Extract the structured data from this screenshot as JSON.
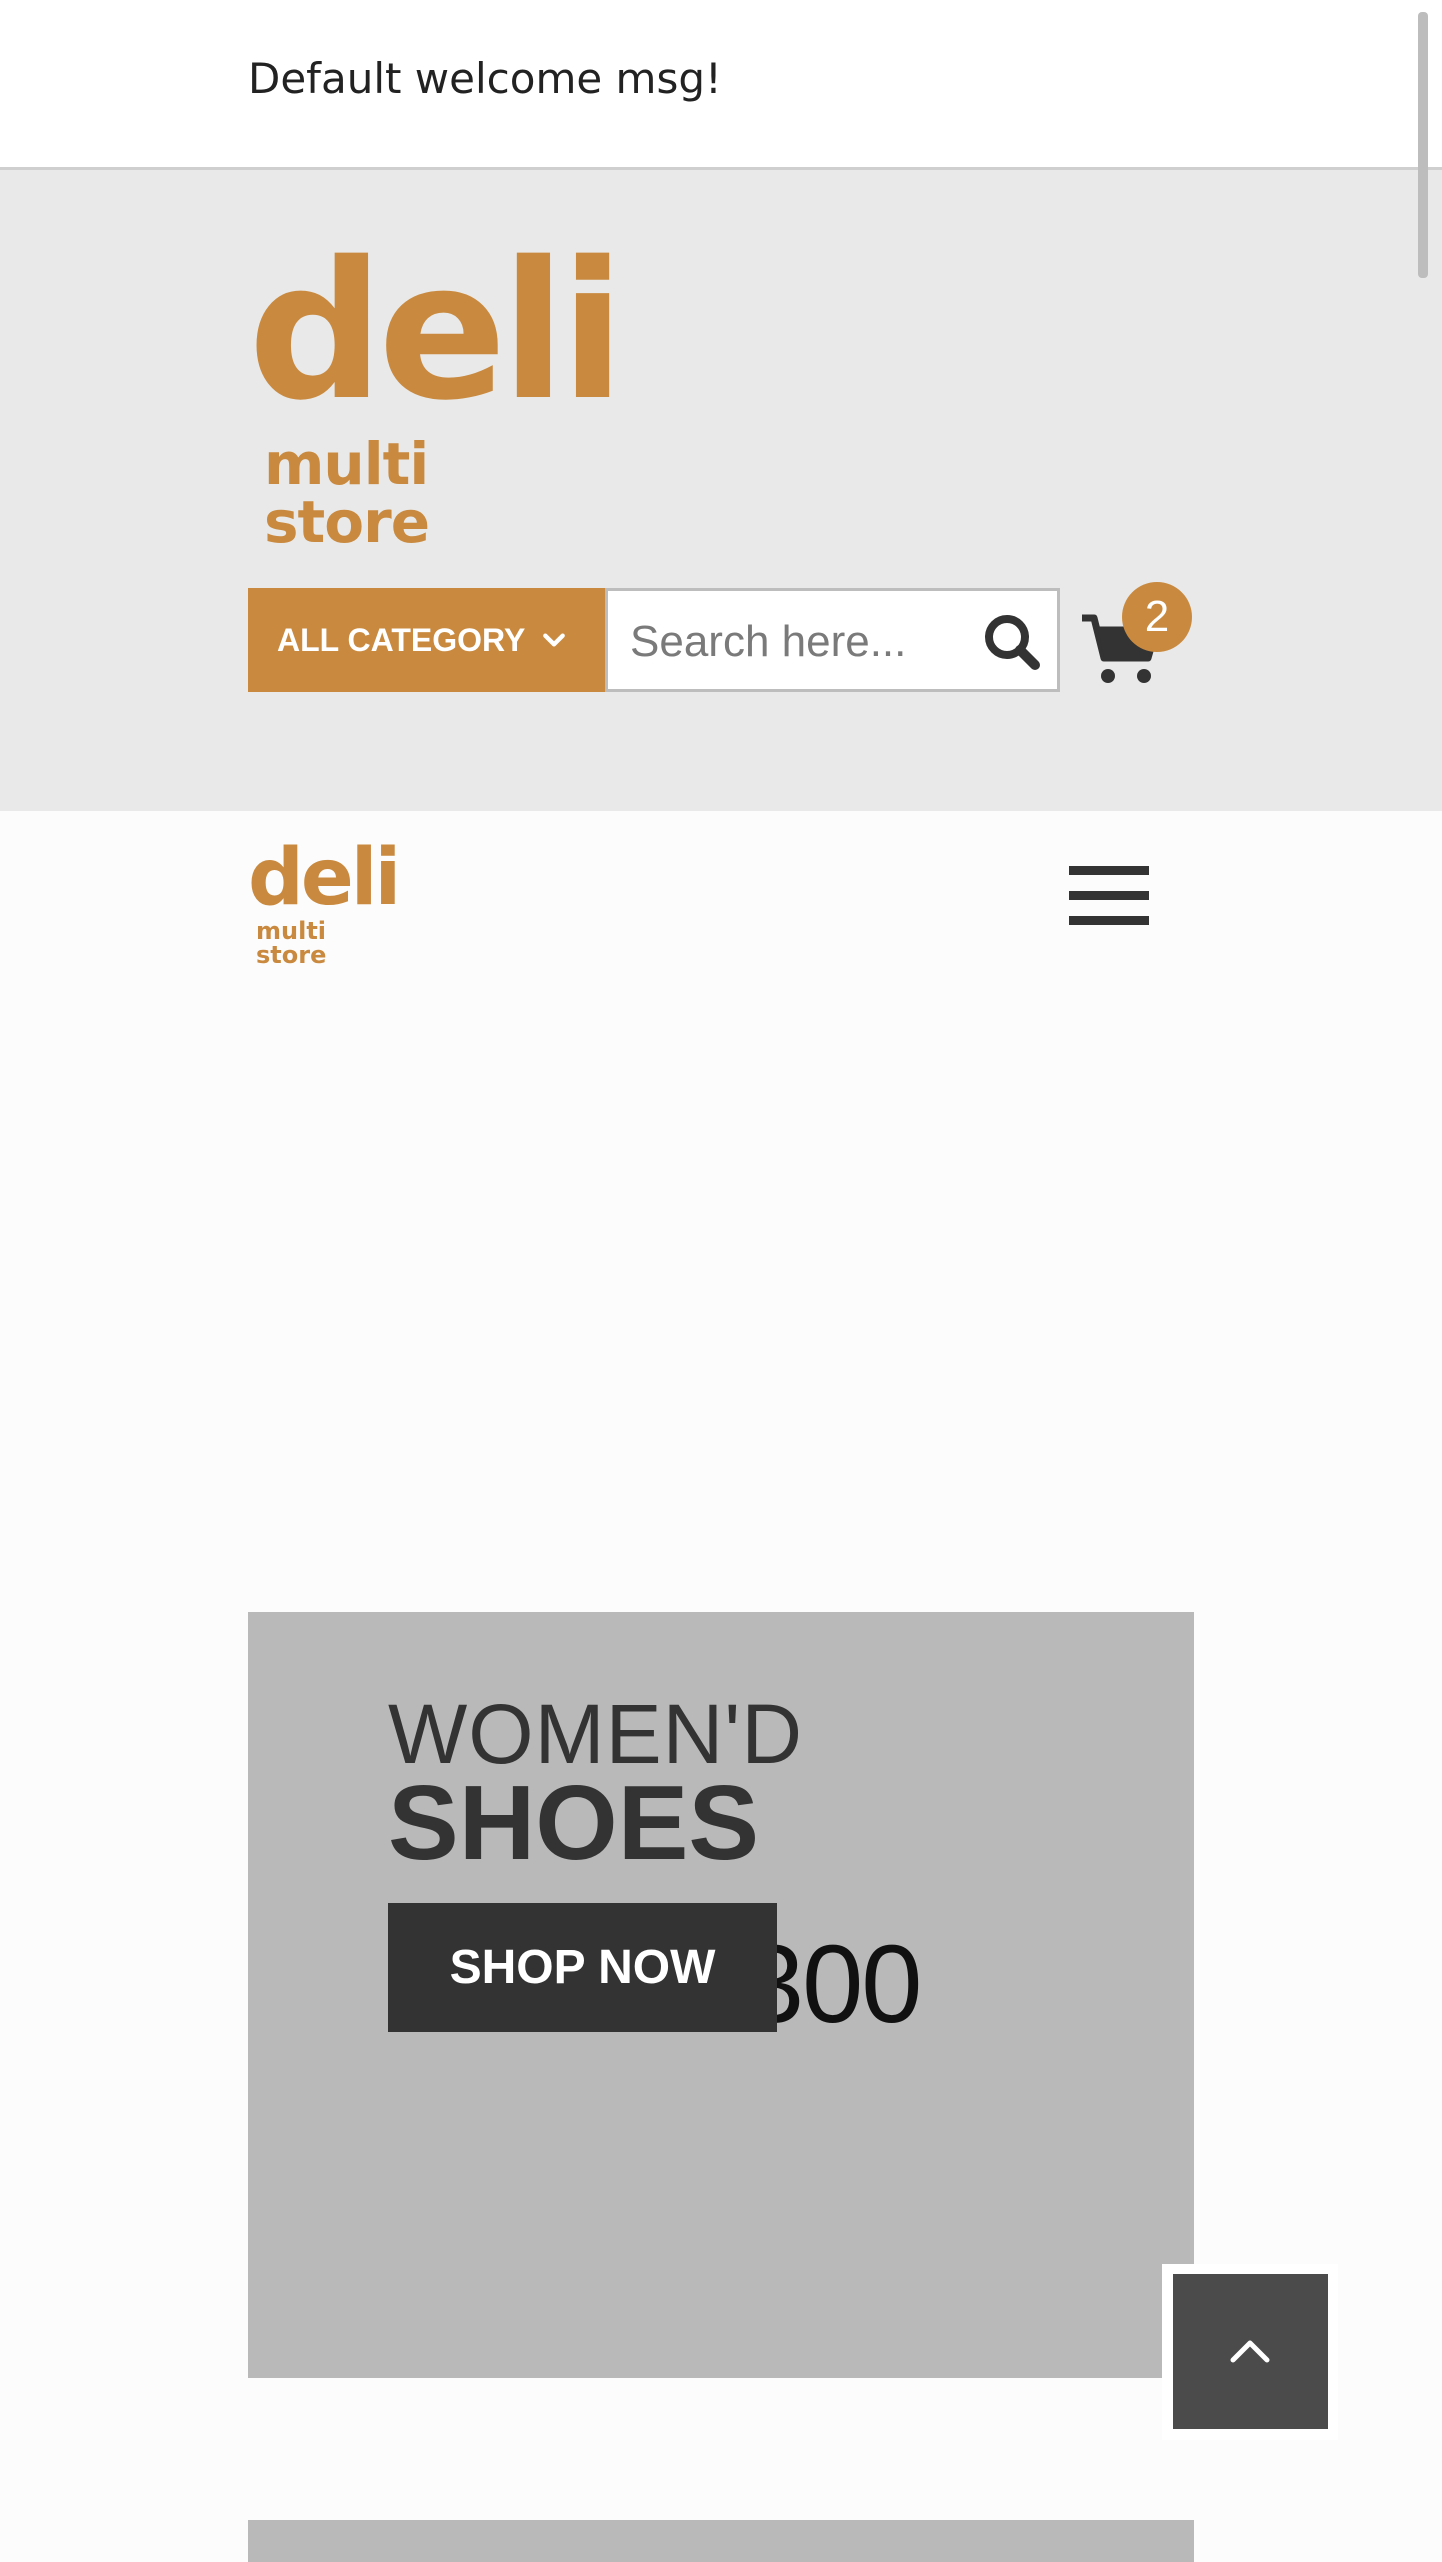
{
  "topbar": {
    "welcome": "Default welcome msg!"
  },
  "brand": {
    "name": "deli",
    "tagline": "multi store",
    "color": "#c98a3f"
  },
  "search": {
    "category_label": "ALL CATEGORY",
    "placeholder": "Search here..."
  },
  "cart": {
    "count": "2"
  },
  "banner": {
    "line1": "WOMEN'D",
    "line2": "SHOES",
    "background_text": "310X300",
    "button_label": "SHOP NOW"
  },
  "icons": {
    "chevron": "chevron-down-icon",
    "search": "search-icon",
    "cart": "cart-icon",
    "menu": "hamburger-menu-icon",
    "back_to_top": "chevron-up-icon"
  }
}
